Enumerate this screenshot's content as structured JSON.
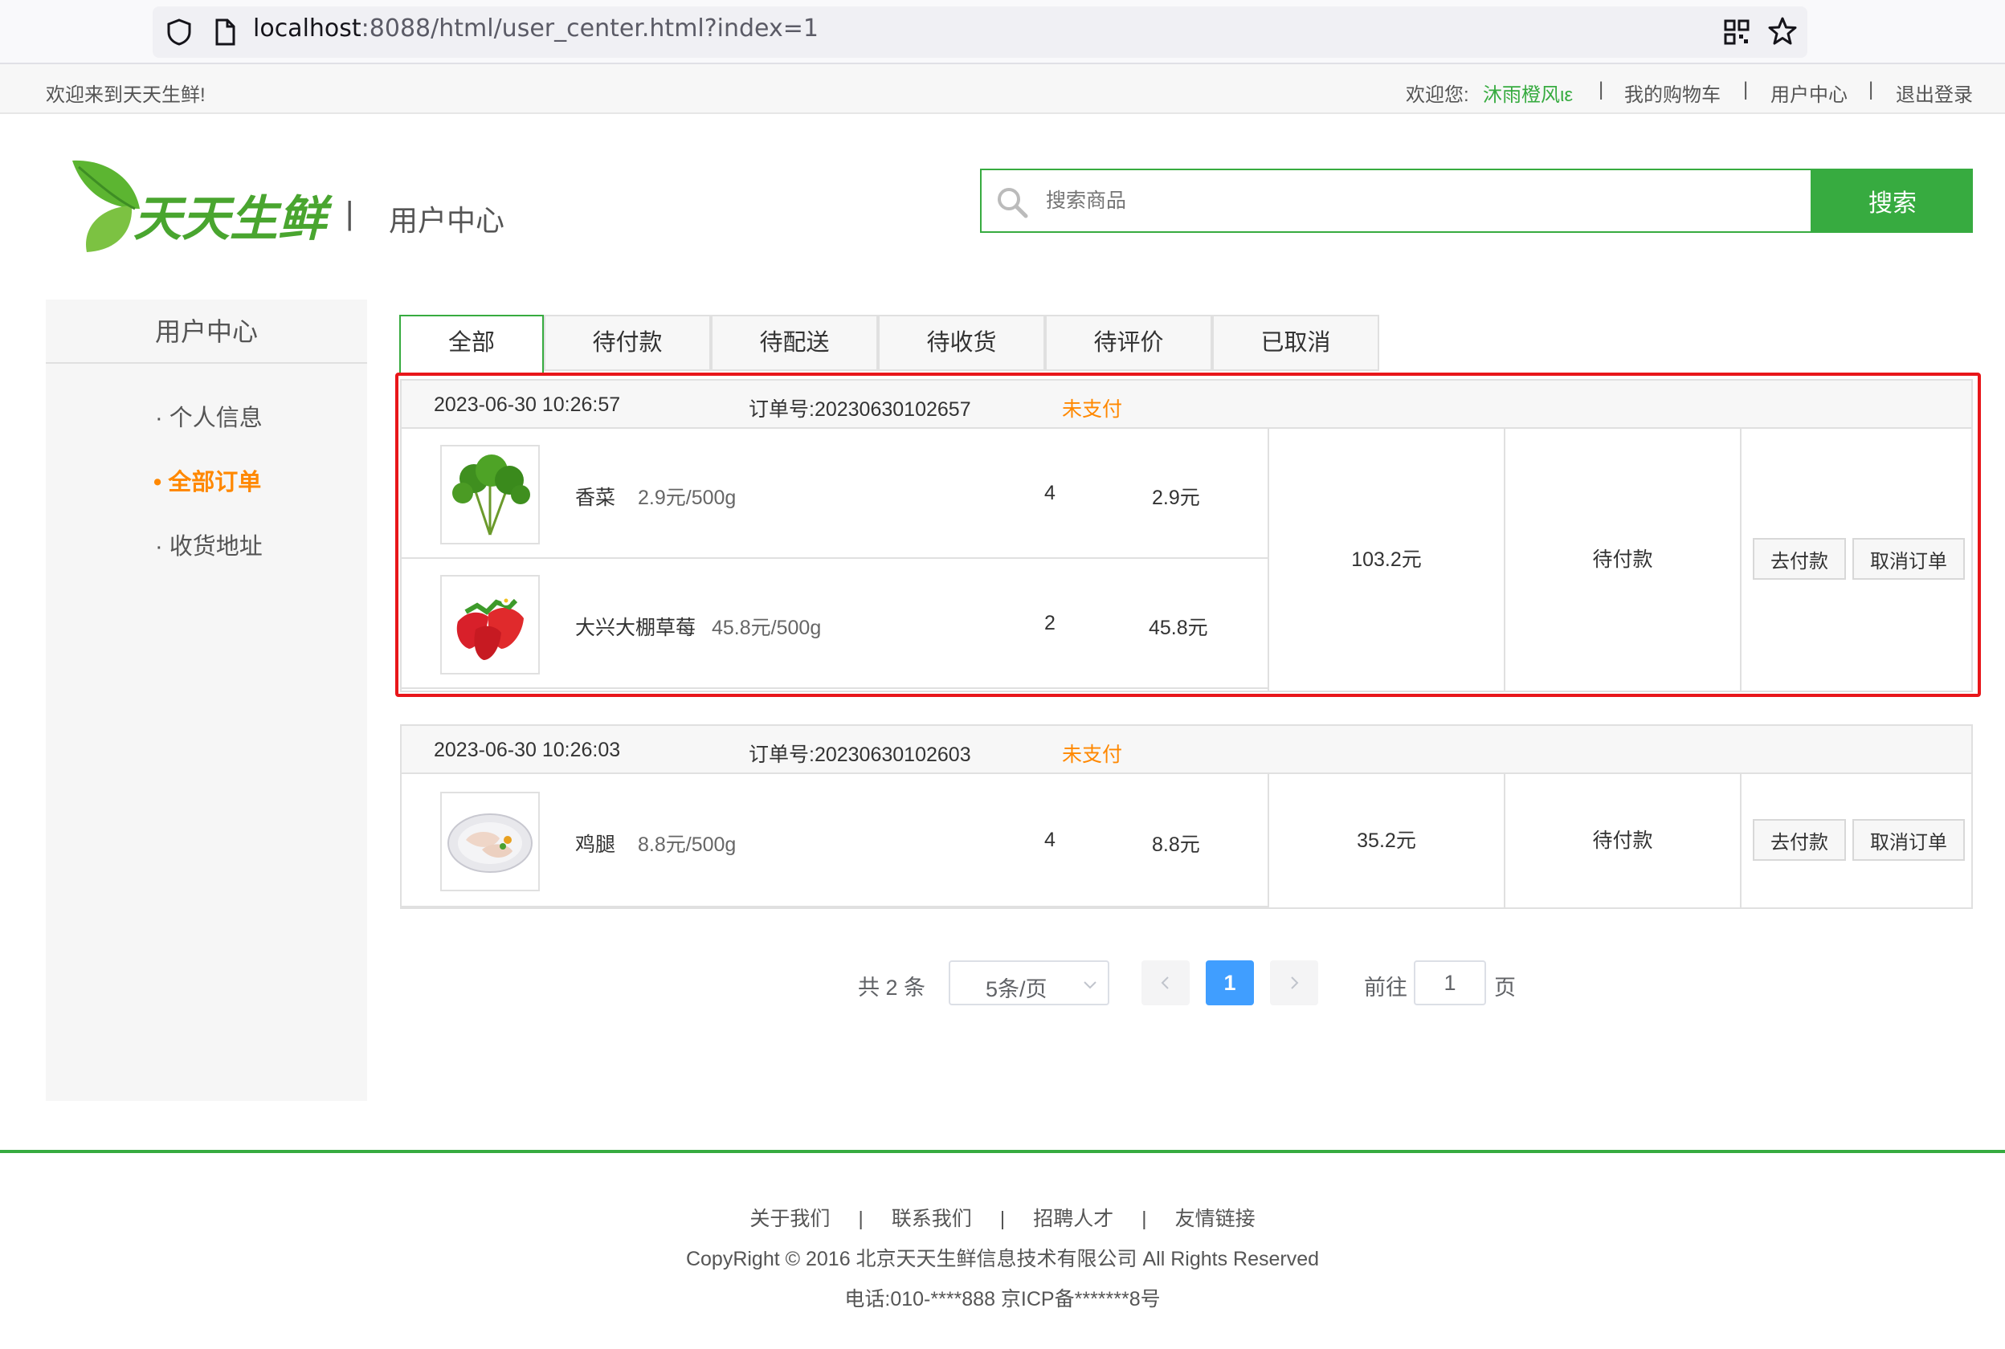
{
  "browser": {
    "url_host": "localhost",
    "url_path": ":8088/html/user_center.html?index=1"
  },
  "topbar": {
    "welcome": "欢迎来到天天生鲜!",
    "greeting": "欢迎您:",
    "username": "沐雨橙风ιε",
    "sep": "|",
    "cart": "我的购物车",
    "user_center": "用户中心",
    "logout": "退出登录"
  },
  "header": {
    "logo_text": "天天生鲜",
    "divider": "|",
    "title": "用户中心",
    "search_placeholder": "搜索商品",
    "search_button": "搜索"
  },
  "sidebar": {
    "title": "用户中心",
    "items": [
      {
        "label": "· 个人信息"
      },
      {
        "label": "• 全部订单"
      },
      {
        "label": "· 收货地址"
      }
    ]
  },
  "tabs": [
    {
      "label": "全部"
    },
    {
      "label": "待付款"
    },
    {
      "label": "待配送"
    },
    {
      "label": "待收货"
    },
    {
      "label": "待评价"
    },
    {
      "label": "已取消"
    }
  ],
  "orders": [
    {
      "time": "2023-06-30 10:26:57",
      "order_no": "订单号:20230630102657",
      "status": "未支付",
      "total": "103.2元",
      "state": "待付款",
      "pay_button": "去付款",
      "cancel_button": "取消订单",
      "goods": [
        {
          "name": "香菜",
          "price": "2.9元/500g",
          "qty": "4",
          "subtotal": "2.9元"
        },
        {
          "name": "大兴大棚草莓",
          "price": "45.8元/500g",
          "qty": "2",
          "subtotal": "45.8元"
        }
      ]
    },
    {
      "time": "2023-06-30 10:26:03",
      "order_no": "订单号:20230630102603",
      "status": "未支付",
      "total": "35.2元",
      "state": "待付款",
      "pay_button": "去付款",
      "cancel_button": "取消订单",
      "goods": [
        {
          "name": "鸡腿",
          "price": "8.8元/500g",
          "qty": "4",
          "subtotal": "8.8元"
        }
      ]
    }
  ],
  "pagination": {
    "total": "共 2 条",
    "page_size": "5条/页",
    "current_page": "1",
    "goto_label": "前往",
    "goto_value": "1",
    "page_suffix": "页"
  },
  "footer": {
    "links": [
      "关于我们",
      "联系我们",
      "招聘人才",
      "友情链接"
    ],
    "sep": "|",
    "copyright": "CopyRight © 2016 北京天天生鲜信息技术有限公司 All Rights Reserved",
    "contact": "电话:010-****888 京ICP备*******8号"
  },
  "colors": {
    "brand_green": "#37ab40",
    "status_orange": "#ff8800",
    "highlight_red": "#e8161a",
    "pager_blue": "#409eff"
  }
}
